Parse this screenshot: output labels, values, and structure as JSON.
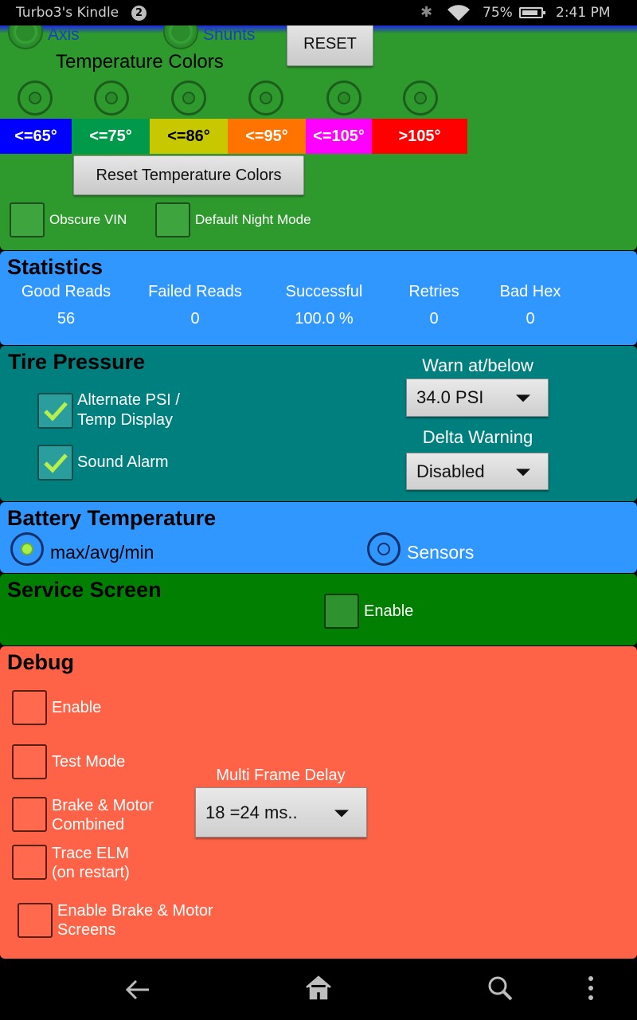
{
  "status_bar": {
    "device_name": "Turbo3's Kindle",
    "notification_count": "2",
    "battery_percent": "75%",
    "time": "2:41 PM"
  },
  "top": {
    "axis_label": "Axis",
    "shunts_label": "Shunts",
    "reset_button": "RESET",
    "temp_colors_title": "Temperature Colors",
    "swatches": [
      {
        "label": "<=65°",
        "bg": "#0000ff",
        "fg": "#ffffff"
      },
      {
        "label": "<=75°",
        "bg": "#009a4a",
        "fg": "#ffffff"
      },
      {
        "label": "<=86°",
        "bg": "#c8c800",
        "fg": "#000000"
      },
      {
        "label": "<=95°",
        "bg": "#ff7300",
        "fg": "#ffffff"
      },
      {
        "label": "<=105°",
        "bg": "#ff00ff",
        "fg": "#ffffff"
      },
      {
        "label": ">105°",
        "bg": "#ff0000",
        "fg": "#ffffff"
      }
    ],
    "reset_temp_colors_button": "Reset Temperature Colors",
    "obscure_vin_label": "Obscure VIN",
    "default_night_mode_label": "Default Night Mode"
  },
  "statistics": {
    "title": "Statistics",
    "columns": [
      {
        "header": "Good Reads",
        "value": "56"
      },
      {
        "header": "Failed Reads",
        "value": "0"
      },
      {
        "header": "Successful",
        "value": "100.0 %"
      },
      {
        "header": "Retries",
        "value": "0"
      },
      {
        "header": "Bad Hex",
        "value": "0"
      }
    ]
  },
  "tire_pressure": {
    "title": "Tire Pressure",
    "alt_psi_line1": "Alternate PSI /",
    "alt_psi_line2": "Temp Display",
    "alt_psi_checked": true,
    "sound_alarm_label": "Sound Alarm",
    "sound_alarm_checked": true,
    "warn_label": "Warn at/below",
    "warn_value": "34.0 PSI",
    "delta_label": "Delta Warning",
    "delta_value": "Disabled"
  },
  "battery_temperature": {
    "title": "Battery Temperature",
    "option_maxavgmin": "max/avg/min",
    "option_sensors": "Sensors",
    "selected": "max/avg/min"
  },
  "service_screen": {
    "title": "Service Screen",
    "enable_label": "Enable"
  },
  "debug": {
    "title": "Debug",
    "enable_label": "Enable",
    "test_mode_label": "Test Mode",
    "brake_motor_line1": "Brake & Motor",
    "brake_motor_line2": "Combined",
    "trace_elm_line1": "Trace ELM",
    "trace_elm_line2": "(on restart)",
    "enable_screens_line1": "Enable Brake & Motor",
    "enable_screens_line2": "Screens",
    "frame_delay_label": "Multi Frame Delay",
    "frame_delay_value": "18 =24 ms.."
  },
  "colors": {
    "top_panel": "#2e9a2e",
    "statistics": "#2f97ff",
    "tire_pressure": "#007f7f",
    "service_screen": "#007f00",
    "debug": "#ff6347"
  },
  "nav": {
    "icons": [
      "back-icon",
      "home-icon",
      "search-icon",
      "overflow-menu-icon"
    ]
  }
}
